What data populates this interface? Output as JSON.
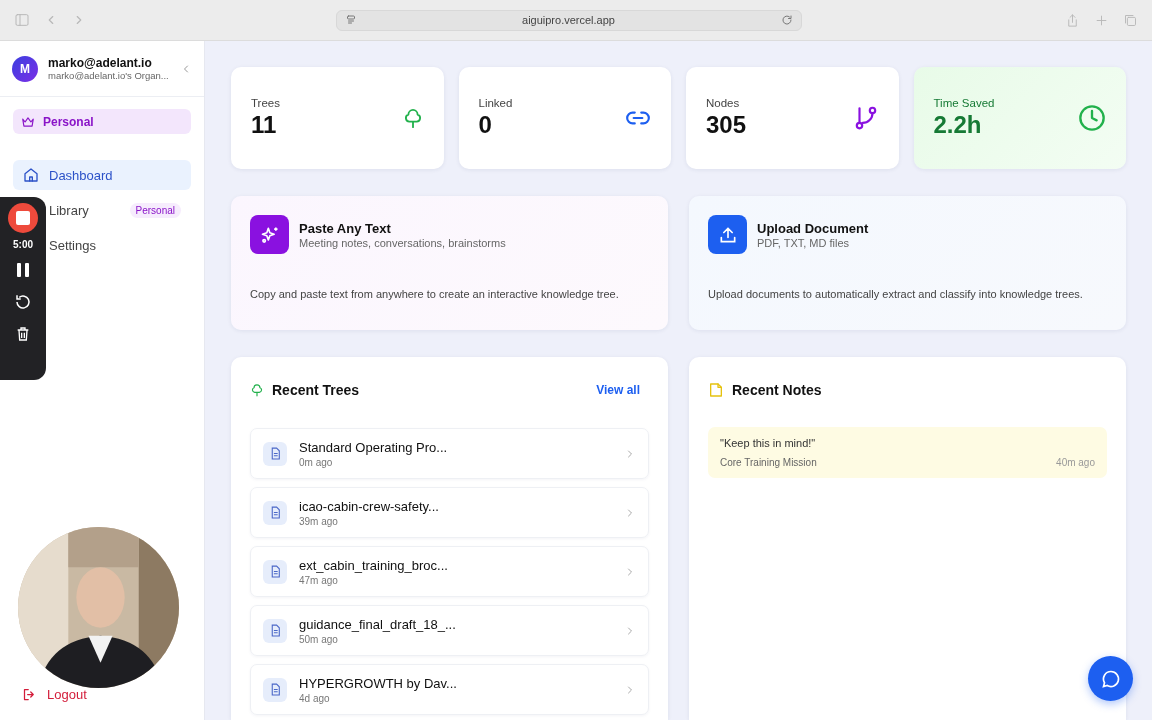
{
  "browser": {
    "url": "aiguipro.vercel.app"
  },
  "account": {
    "avatar": "M",
    "email": "marko@adelant.io",
    "org": "marko@adelant.io's Organ..."
  },
  "plan": {
    "label": "Personal"
  },
  "nav": [
    {
      "label": "Dashboard",
      "kind": "home",
      "selected": true
    },
    {
      "label": "Library",
      "kind": "library",
      "selected": false,
      "badge": "Personal"
    },
    {
      "label": "Settings",
      "kind": "settings",
      "selected": false
    }
  ],
  "logout": "Logout",
  "recorder": {
    "time": "5:00"
  },
  "stats": [
    {
      "label": "Trees",
      "value": "11",
      "kind": "tree"
    },
    {
      "label": "Linked",
      "value": "0",
      "kind": "link"
    },
    {
      "label": "Nodes",
      "value": "305",
      "kind": "branch"
    },
    {
      "label": "Time Saved",
      "value": "2.2h",
      "kind": "clock"
    }
  ],
  "actions": [
    {
      "title": "Paste Any Text",
      "subtitle": "Meeting notes, conversations, brainstorms",
      "body": "Copy and paste text from anywhere to create an interactive knowledge tree.",
      "kind": "paste"
    },
    {
      "title": "Upload Document",
      "subtitle": "PDF, TXT, MD files",
      "body": "Upload documents to automatically extract and classify into knowledge trees.",
      "kind": "upload"
    }
  ],
  "recent_trees": {
    "title": "Recent Trees",
    "link": "View all",
    "items": [
      {
        "title": "Standard Operating Pro...",
        "time": "0m ago"
      },
      {
        "title": "icao-cabin-crew-safety...",
        "time": "39m ago"
      },
      {
        "title": "ext_cabin_training_broc...",
        "time": "47m ago"
      },
      {
        "title": "guidance_final_draft_18_...",
        "time": "50m ago"
      },
      {
        "title": "HYPERGROWTH by Dav...",
        "time": "4d ago"
      }
    ]
  },
  "recent_notes": {
    "title": "Recent Notes",
    "items": [
      {
        "text": "\"Keep this in mind!\"",
        "source": "Core Training Mission",
        "time": "40m ago"
      }
    ]
  }
}
